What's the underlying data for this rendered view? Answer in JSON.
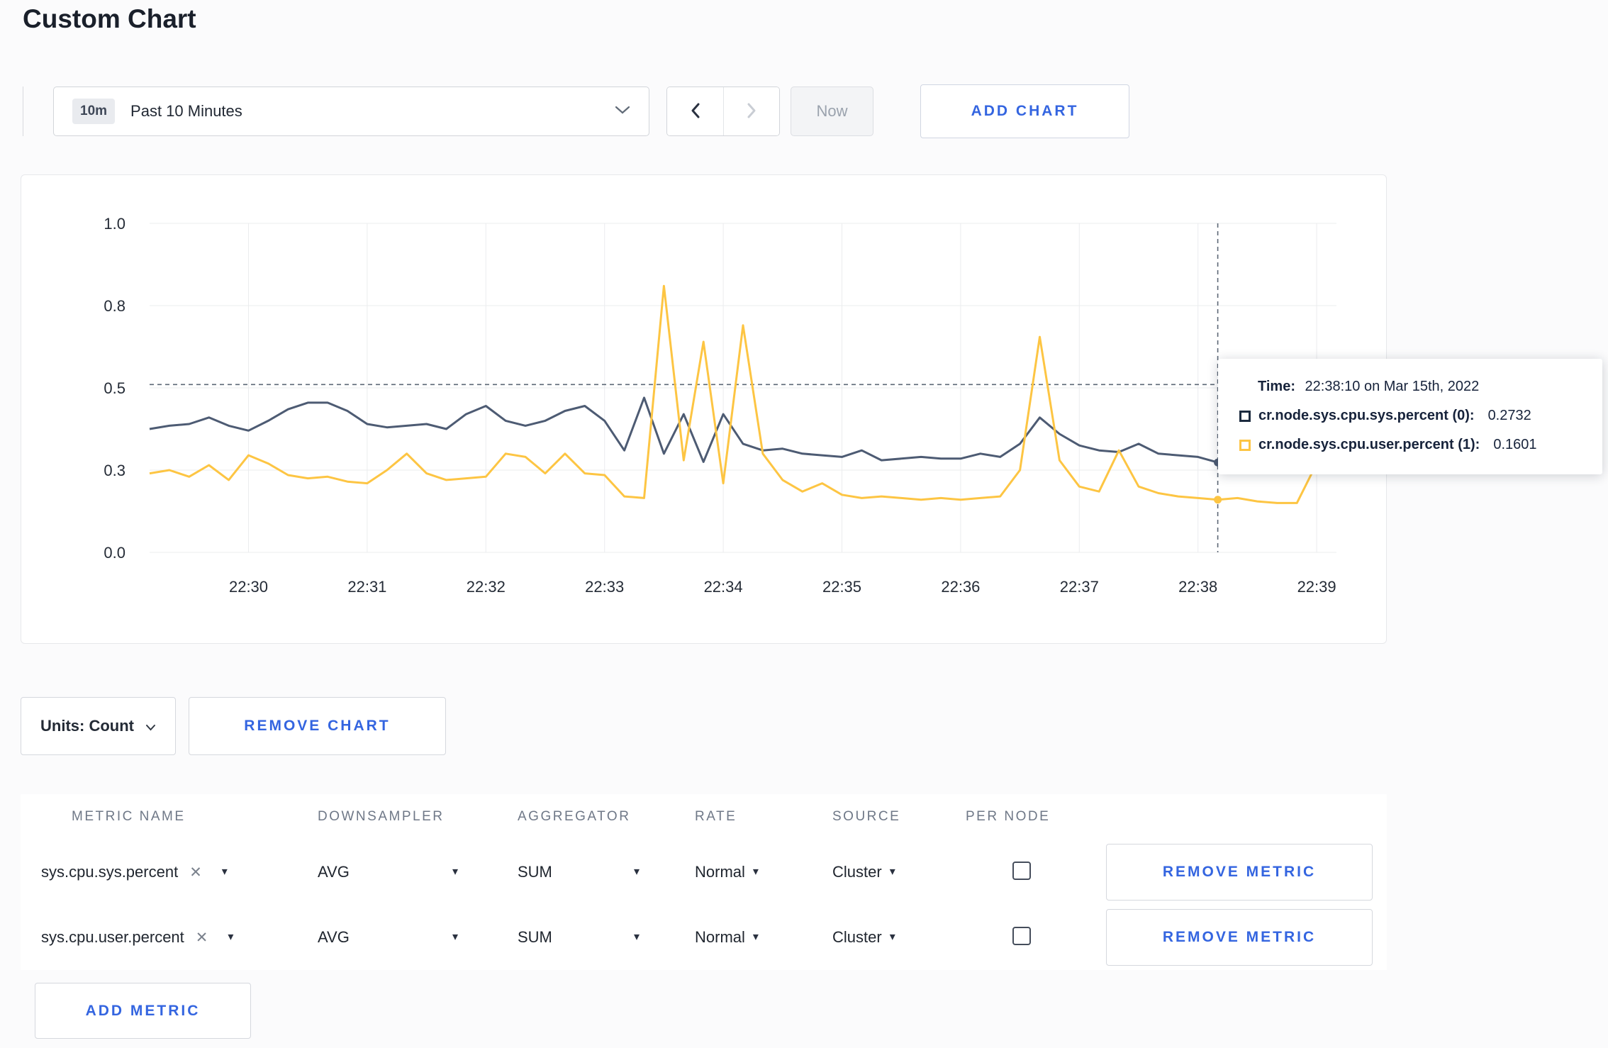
{
  "page": {
    "title": "Custom Chart"
  },
  "toolbar": {
    "range_badge": "10m",
    "range_label": "Past 10 Minutes",
    "now_label": "Now",
    "add_chart_label": "ADD CHART"
  },
  "chart_data": {
    "type": "line",
    "x_start_time": "22:29:10",
    "x_step_seconds": 10,
    "ylim": [
      0,
      1
    ],
    "grid": true,
    "legend_position": "tooltip",
    "y_ticks": [
      {
        "label": "1.0",
        "value": 1.0
      },
      {
        "label": "0.8",
        "value": 0.75
      },
      {
        "label": "0.5",
        "value": 0.5
      },
      {
        "label": "0.3",
        "value": 0.25
      },
      {
        "label": "0.0",
        "value": 0.0
      }
    ],
    "x_ticks": [
      {
        "label": "22:30",
        "index": 5
      },
      {
        "label": "22:31",
        "index": 11
      },
      {
        "label": "22:32",
        "index": 17
      },
      {
        "label": "22:33",
        "index": 23
      },
      {
        "label": "22:34",
        "index": 29
      },
      {
        "label": "22:35",
        "index": 35
      },
      {
        "label": "22:36",
        "index": 41
      },
      {
        "label": "22:37",
        "index": 47
      },
      {
        "label": "22:38",
        "index": 53
      },
      {
        "label": "22:39",
        "index": 59
      }
    ],
    "series": [
      {
        "name": "cr.node.sys.cpu.sys.percent (0)",
        "color": "#4d5b73",
        "values": [
          0.375,
          0.385,
          0.39,
          0.41,
          0.385,
          0.37,
          0.4,
          0.435,
          0.455,
          0.455,
          0.43,
          0.39,
          0.38,
          0.385,
          0.39,
          0.375,
          0.42,
          0.445,
          0.4,
          0.385,
          0.4,
          0.43,
          0.445,
          0.4,
          0.31,
          0.47,
          0.3,
          0.42,
          0.275,
          0.42,
          0.33,
          0.31,
          0.315,
          0.3,
          0.295,
          0.29,
          0.31,
          0.28,
          0.285,
          0.29,
          0.285,
          0.285,
          0.3,
          0.29,
          0.33,
          0.41,
          0.36,
          0.325,
          0.31,
          0.305,
          0.33,
          0.3,
          0.295,
          0.29,
          0.2732,
          0.28,
          0.285,
          0.31,
          0.32,
          0.3,
          0.31
        ]
      },
      {
        "name": "cr.node.sys.cpu.user.percent (1)",
        "color": "#fdc543",
        "values": [
          0.24,
          0.25,
          0.23,
          0.265,
          0.22,
          0.295,
          0.27,
          0.235,
          0.225,
          0.23,
          0.215,
          0.21,
          0.25,
          0.3,
          0.24,
          0.22,
          0.225,
          0.23,
          0.3,
          0.29,
          0.24,
          0.3,
          0.24,
          0.235,
          0.17,
          0.165,
          0.81,
          0.28,
          0.64,
          0.21,
          0.69,
          0.3,
          0.22,
          0.185,
          0.21,
          0.175,
          0.165,
          0.17,
          0.165,
          0.16,
          0.165,
          0.16,
          0.165,
          0.17,
          0.25,
          0.655,
          0.28,
          0.2,
          0.185,
          0.31,
          0.2,
          0.18,
          0.17,
          0.165,
          0.1601,
          0.165,
          0.155,
          0.15,
          0.15,
          0.27,
          0.24
        ]
      }
    ],
    "crosshair": {
      "x_index": 54,
      "time": "22:38:10",
      "hline_value": 0.51
    }
  },
  "tooltip": {
    "time_label": "Time:",
    "time_value": "22:38:10 on Mar 15th, 2022",
    "entries": [
      {
        "name": "cr.node.sys.cpu.sys.percent (0):",
        "value": "0.2732",
        "color": "#1c2b3f"
      },
      {
        "name": "cr.node.sys.cpu.user.percent (1):",
        "value": "0.1601",
        "color": "#fdc543"
      }
    ]
  },
  "chart_controls": {
    "units_label": "Units: Count",
    "remove_chart_label": "REMOVE CHART"
  },
  "metrics_table": {
    "headers": [
      "METRIC NAME",
      "DOWNSAMPLER",
      "AGGREGATOR",
      "RATE",
      "SOURCE",
      "PER NODE"
    ],
    "rows": [
      {
        "metric": "sys.cpu.sys.percent",
        "downsampler": "AVG",
        "aggregator": "SUM",
        "rate": "Normal",
        "source": "Cluster",
        "per_node_checked": false,
        "remove_label": "REMOVE METRIC"
      },
      {
        "metric": "sys.cpu.user.percent",
        "downsampler": "AVG",
        "aggregator": "SUM",
        "rate": "Normal",
        "source": "Cluster",
        "per_node_checked": false,
        "remove_label": "REMOVE METRIC"
      }
    ],
    "add_metric_label": "ADD METRIC"
  },
  "colors": {
    "accent_blue": "#3465e0",
    "series_sys": "#4d5b73",
    "series_user": "#fdc543"
  }
}
